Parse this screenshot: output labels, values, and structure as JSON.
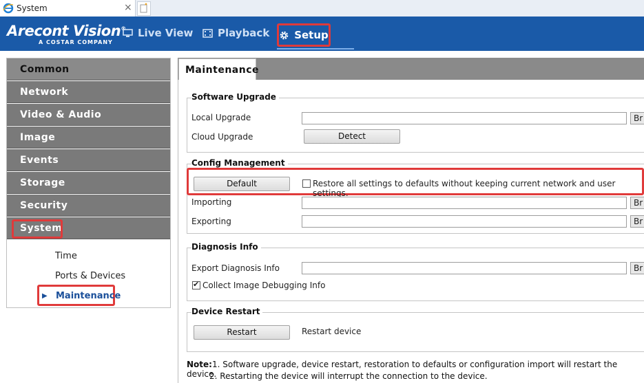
{
  "browser": {
    "tab_title": "System",
    "close_glyph": "×",
    "icons": [
      "ie-icon",
      "close-icon",
      "new-tab-icon"
    ]
  },
  "brand": {
    "name": "Arecont Vision",
    "reg": "®",
    "tagline": "A COSTAR COMPANY",
    "header_color": "#1a5aa8"
  },
  "nav": {
    "live": "Live View",
    "playback": "Playback",
    "setup": "Setup",
    "icons": [
      "monitor-icon",
      "film-icon",
      "gear-icon"
    ]
  },
  "sidebar": {
    "items": [
      "Common",
      "Network",
      "Video & Audio",
      "Image",
      "Events",
      "Storage",
      "Security",
      "System"
    ],
    "sub_items": [
      "Time",
      "Ports & Devices",
      "Maintenance"
    ],
    "active_sub": "Maintenance"
  },
  "main": {
    "tab": "Maintenance",
    "software_upgrade": {
      "title": "Software Upgrade",
      "local": "Local Upgrade",
      "cloud": "Cloud Upgrade",
      "detect": "Detect",
      "browse": "Br"
    },
    "config": {
      "title": "Config Management",
      "default": "Default",
      "restore_label": "Restore all settings to defaults without keeping current network and user settings.",
      "restore_checked": false,
      "importing": "Importing",
      "exporting": "Exporting"
    },
    "diagnosis": {
      "title": "Diagnosis Info",
      "export": "Export Diagnosis Info",
      "collect": "Collect Image Debugging Info",
      "collect_checked": true
    },
    "restart": {
      "title": "Device Restart",
      "button": "Restart",
      "label": "Restart device"
    },
    "note": {
      "label": "Note:",
      "line1": "1. Software upgrade, device restart, restoration to defaults or configuration import will restart the device.",
      "line2": "2. Restarting the device will interrupt the connection to the device."
    }
  },
  "colors": {
    "highlight": "#e03a3a",
    "sidebar_gray": "#7a7a7a",
    "active_link": "#1a4f9a"
  }
}
